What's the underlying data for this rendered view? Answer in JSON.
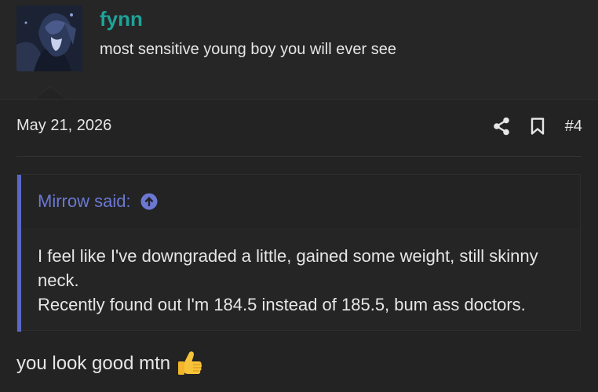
{
  "user": {
    "name": "fynn",
    "title": "most sensitive young boy you will ever see"
  },
  "post": {
    "date": "May 21, 2026",
    "number": "#4"
  },
  "quote": {
    "author_label": "Mirrow said:",
    "lines": [
      "I feel like I've downgraded a little, gained some weight, still skinny",
      "neck.",
      "Recently found out I'm 184.5 instead of 185.5, bum ass doctors."
    ]
  },
  "reply": {
    "text": "you look good mtn"
  },
  "icons": {
    "share": "share-icon",
    "bookmark": "bookmark-icon",
    "jump": "arrow-up-circle-icon",
    "emoji": "thumbs-up-emoji"
  },
  "colors": {
    "username": "#1ea39a",
    "quote_accent": "#5b67c7",
    "background": "#232323"
  }
}
